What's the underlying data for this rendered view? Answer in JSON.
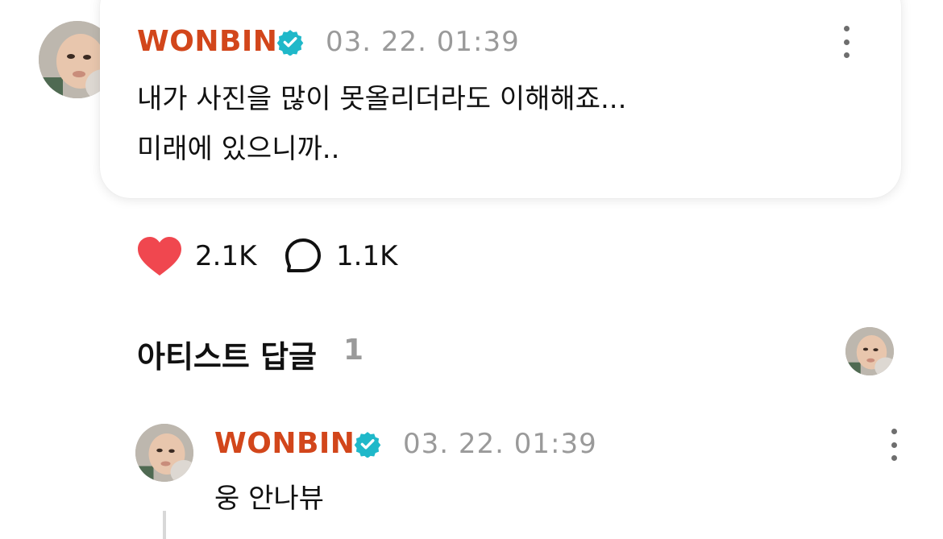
{
  "post": {
    "author": "WONBIN",
    "timestamp": "03. 22. 01:39",
    "text_line1": "내가 사진을 많이 못올리더라도 이해해죠...",
    "text_line2": "미래에 있으니까..",
    "likes": "2.1K",
    "comments": "1.1K"
  },
  "artist_replies": {
    "title": "아티스트 답글",
    "count": "1"
  },
  "reply": {
    "author": "WONBIN",
    "timestamp": "03. 22. 01:39",
    "text": "웅 안나뷰"
  },
  "colors": {
    "author": "#d2461b",
    "verified": "#1fb8c9",
    "heart": "#f0474f",
    "muted": "#9a9a9a"
  },
  "icons": {
    "verified": "verified-badge-icon",
    "more": "more-vertical-icon",
    "heart": "heart-icon",
    "comment": "speech-bubble-icon"
  }
}
